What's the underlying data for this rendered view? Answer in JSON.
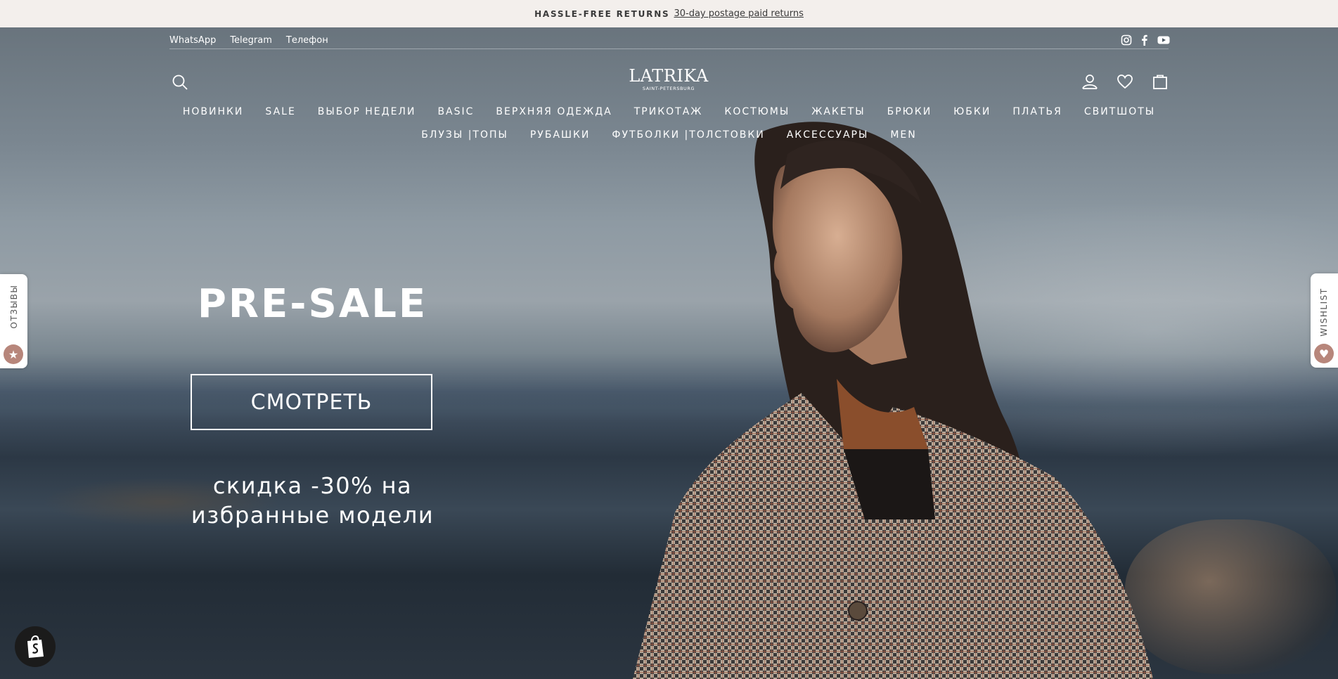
{
  "announcement": {
    "strong": "HASSLE-FREE RETURNS",
    "link": "30-day postage paid returns"
  },
  "utility": {
    "links": [
      "WhatsApp",
      "Telegram",
      "Телефон"
    ],
    "social": [
      "instagram-icon",
      "facebook-icon",
      "youtube-icon"
    ]
  },
  "logo": {
    "name": "LATRIKA",
    "sub": "SAINT-PETERSBURG"
  },
  "nav": {
    "row1": [
      "НОВИНКИ",
      "SALE",
      "ВЫБОР НЕДЕЛИ",
      "BASIC",
      "ВЕРХНЯЯ ОДЕЖДА",
      "ТРИКОТАЖ",
      "КОСТЮМЫ",
      "ЖАКЕТЫ",
      "БРЮКИ",
      "ЮБКИ",
      "ПЛАТЬЯ",
      "СВИТШОТЫ"
    ],
    "row2": [
      "БЛУЗЫ |ТОПЫ",
      "РУБАШКИ",
      "ФУТБОЛКИ |ТОЛСТОВКИ",
      "АКСЕССУАРЫ",
      "MEN"
    ]
  },
  "hero": {
    "title": "PRE-SALE",
    "cta": "СМОТРЕТЬ",
    "discount_line1": "скидка -30% на",
    "discount_line2": "избранные модели"
  },
  "side_tabs": {
    "left": "ОТЗЫВЫ",
    "right": "WISHLIST"
  },
  "colors": {
    "announcement_bg": "#f3efec",
    "badge_accent": "#b7867b",
    "text_light": "#ffffff"
  }
}
